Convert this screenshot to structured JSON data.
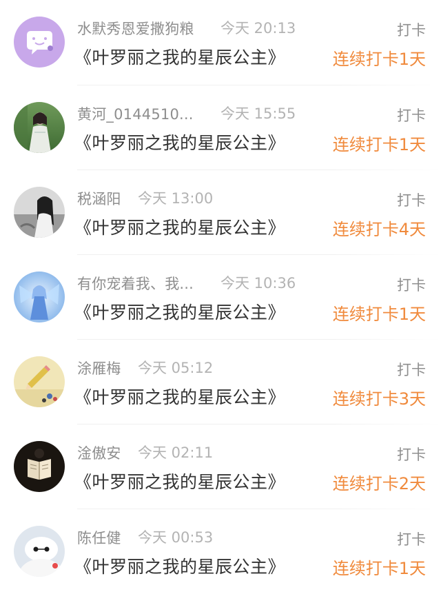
{
  "items": [
    {
      "username": "水默秀恩爱撒狗粮",
      "time": "今天 20:13",
      "title": "《叶罗丽之我的星辰公主》",
      "tag": "打卡",
      "streak": "连续打卡1天",
      "avatar": "chat-bubble-avatar"
    },
    {
      "username": "黄河_0144510...",
      "time": "今天 15:55",
      "title": "《叶罗丽之我的星辰公主》",
      "tag": "打卡",
      "streak": "连续打卡1天",
      "avatar": "girl-photo-avatar"
    },
    {
      "username": "税涵阳",
      "time": "今天 13:00",
      "title": "《叶罗丽之我的星辰公主》",
      "tag": "打卡",
      "streak": "连续打卡4天",
      "avatar": "grayscale-girl-avatar"
    },
    {
      "username": "有你宠着我、我...",
      "time": "今天 10:36",
      "title": "《叶罗丽之我的星辰公主》",
      "tag": "打卡",
      "streak": "连续打卡1天",
      "avatar": "anime-fairy-avatar"
    },
    {
      "username": "涂雁梅",
      "time": "今天 05:12",
      "title": "《叶罗丽之我的星辰公主》",
      "tag": "打卡",
      "streak": "连续打卡3天",
      "avatar": "pencil-doodle-avatar"
    },
    {
      "username": "淦傲安",
      "time": "今天 02:11",
      "title": "《叶罗丽之我的星辰公主》",
      "tag": "打卡",
      "streak": "连续打卡2天",
      "avatar": "book-reading-avatar"
    },
    {
      "username": "陈任健",
      "time": "今天 00:53",
      "title": "《叶罗丽之我的星辰公主》",
      "tag": "打卡",
      "streak": "连续打卡1天",
      "avatar": "baymax-avatar"
    }
  ],
  "colors": {
    "accent": "#f08a3c",
    "username": "#8e8e8e",
    "time": "#b3b3b3",
    "title": "#333333"
  }
}
